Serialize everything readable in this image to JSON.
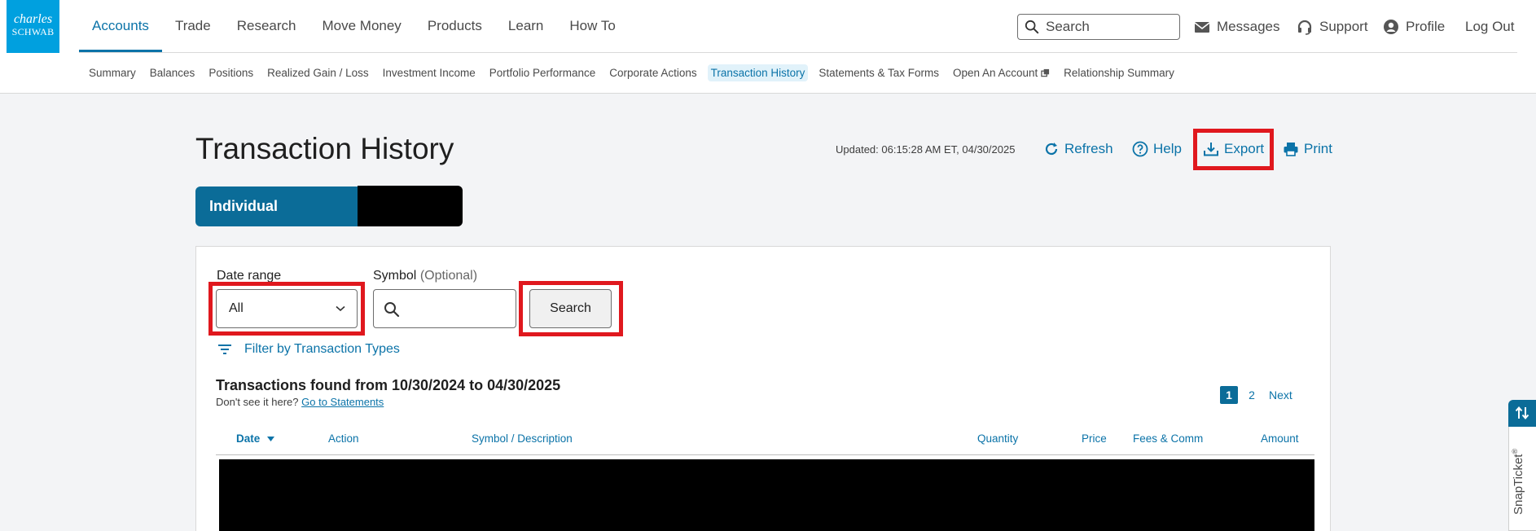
{
  "brand": {
    "line1": "charles",
    "line2": "SCHWAB"
  },
  "nav": {
    "items": [
      "Accounts",
      "Trade",
      "Research",
      "Move Money",
      "Products",
      "Learn",
      "How To"
    ],
    "active_index": 0
  },
  "header": {
    "search_placeholder": "Search",
    "messages": "Messages",
    "support": "Support",
    "profile": "Profile",
    "logout": "Log Out"
  },
  "subnav": {
    "items": [
      "Summary",
      "Balances",
      "Positions",
      "Realized Gain / Loss",
      "Investment Income",
      "Portfolio Performance",
      "Corporate Actions",
      "Transaction History",
      "Statements & Tax Forms",
      "Open An Account",
      "Relationship Summary"
    ],
    "active_index": 7
  },
  "page": {
    "title": "Transaction History",
    "updated": "Updated: 06:15:28 AM ET, 04/30/2025",
    "refresh": "Refresh",
    "help": "Help",
    "export": "Export",
    "print": "Print"
  },
  "account": {
    "tab_label": "Individual"
  },
  "filters": {
    "date_range_label": "Date range",
    "date_range_value": "All",
    "symbol_label": "Symbol",
    "symbol_optional": "(Optional)",
    "search_button": "Search",
    "filter_link": "Filter by Transaction Types"
  },
  "results": {
    "found_text": "Transactions found from 10/30/2024 to 04/30/2025",
    "not_seen": "Don't see it here?",
    "statements_link": "Go to Statements"
  },
  "pagination": {
    "pages": [
      "1",
      "2"
    ],
    "active": "1",
    "next": "Next"
  },
  "table": {
    "columns": [
      "Date",
      "Action",
      "Symbol / Description",
      "Quantity",
      "Price",
      "Fees & Comm",
      "Amount"
    ]
  },
  "snapticket": {
    "label": "SnapTicket",
    "mark": "®"
  },
  "colors": {
    "accent": "#0b73a8",
    "brand_blue": "#00a0df",
    "highlight": "#e0181e",
    "tab_blue": "#0b6c98"
  }
}
